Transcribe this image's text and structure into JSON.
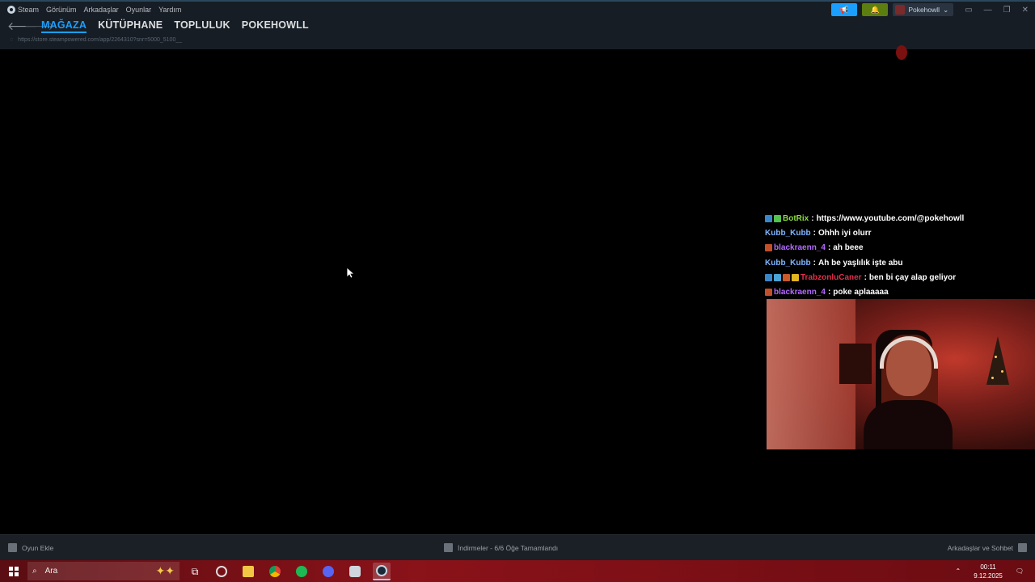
{
  "menubar": {
    "items": [
      "Steam",
      "Görünüm",
      "Arkadaşlar",
      "Oyunlar",
      "Yardım"
    ]
  },
  "nav": {
    "tabs": [
      {
        "label": "MAĞAZA",
        "active": true
      },
      {
        "label": "KÜTÜPHANE",
        "active": false
      },
      {
        "label": "TOPLULUK",
        "active": false
      },
      {
        "label": "POKEHOWLL",
        "active": false
      }
    ],
    "url": "https://store.steampowered.com/app/2264310?snr=5000_5100__"
  },
  "account": {
    "name": "Pokehowll",
    "accent_blue": "#1a9fff",
    "accent_green": "#5c7e10"
  },
  "chat": {
    "messages": [
      {
        "user": "BotRix",
        "color": "#8ade3f",
        "text": "https://www.youtube.com/@pokehowll",
        "badges": [
          "#3b86c9",
          "#53c24e"
        ]
      },
      {
        "user": "Kubb_Kubb",
        "color": "#7fb4ff",
        "text": "Ohhh iyi olurr",
        "badges": []
      },
      {
        "user": "blackraenn_4",
        "color": "#b36bff",
        "text": "ah beee",
        "badges": [
          "#c1502a"
        ]
      },
      {
        "user": "Kubb_Kubb",
        "color": "#7fb4ff",
        "text": "Ah be yaşlılık işte abu",
        "badges": []
      },
      {
        "user": "TrabzonluCaner",
        "color": "#e0304a",
        "text": "ben bi çay alap geliyor",
        "badges": [
          "#3b86c9",
          "#4aa3d6",
          "#c85a2a",
          "#e3b521"
        ]
      },
      {
        "user": "blackraenn_4",
        "color": "#b36bff",
        "text": "poke aplaaaaa",
        "badges": [
          "#c1502a"
        ]
      }
    ]
  },
  "bottombar": {
    "add_game": "Oyun Ekle",
    "downloads": "İndirmeler - 6/6 Öğe Tamamlandı",
    "friends": "Arkadaşlar ve Sohbet"
  },
  "taskbar": {
    "search_placeholder": "Ara",
    "time": "00:11",
    "date": "9.12.2025"
  }
}
